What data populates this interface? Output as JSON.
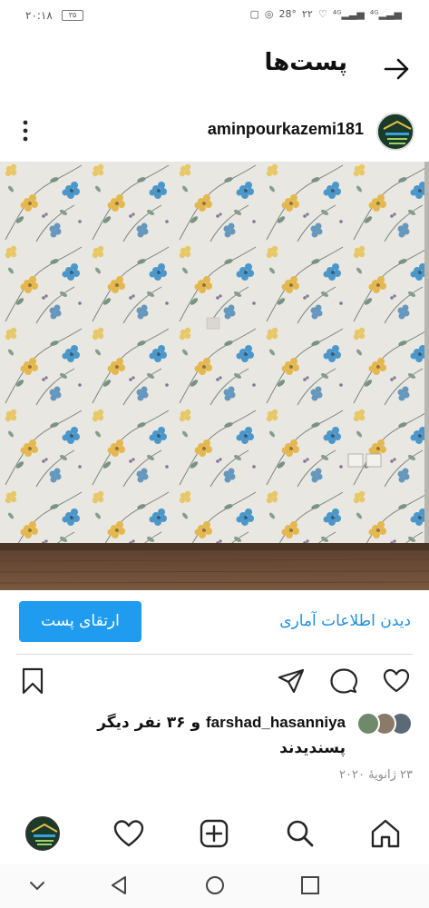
{
  "status_bar": {
    "time": "۲۰:۱۸",
    "battery": "۳۵",
    "temperature": "28°",
    "right_text": "۲۲"
  },
  "header": {
    "title": "پست‌ها"
  },
  "post": {
    "username": "aminpourkazemi181",
    "promote_label": "ارتقای پست",
    "insights_label": "دیدن اطلاعات آماری",
    "likes": {
      "first_liker": "farshad_hasanniya",
      "others": "و ۳۶ نفر دیگر",
      "liked_word": "پسندیدند"
    },
    "date": "۲۳ ژانویهٔ ۲۰۲۰"
  },
  "colors": {
    "accent": "#1f9cf0",
    "link": "#1f8fe0",
    "wall": "#e8e6e0",
    "floor": "#6b4a32"
  }
}
